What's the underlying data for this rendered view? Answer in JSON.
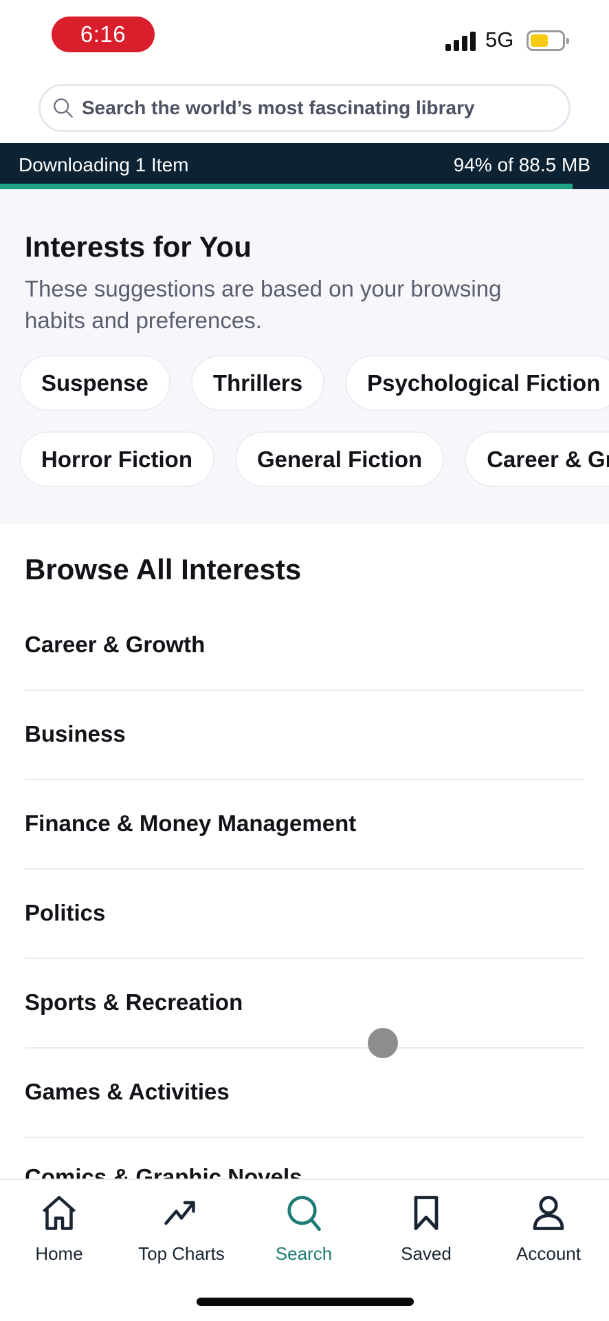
{
  "status_bar": {
    "time": "6:16",
    "network": "5G",
    "battery_level": 0.62,
    "battery_color": "#f6cb12",
    "time_pill_color": "#d91f2b"
  },
  "search": {
    "placeholder": "Search the world’s most fascinating library",
    "value": ""
  },
  "download_banner": {
    "label": "Downloading 1 Item",
    "progress_text": "94% of 88.5 MB",
    "progress_fraction": 0.94,
    "accent": "#1ea386"
  },
  "interests_for_you": {
    "title": "Interests for You",
    "description": "These suggestions are based on your browsing habits and preferences.",
    "chips_row1": [
      "Suspense",
      "Thrillers",
      "Psychological Fiction"
    ],
    "chips_row2": [
      "Horror Fiction",
      "General Fiction",
      "Career & Growth"
    ]
  },
  "browse_all": {
    "title": "Browse All Interests",
    "items": [
      "Career & Growth",
      "Business",
      "Finance & Money Management",
      "Politics",
      "Sports & Recreation",
      "Games & Activities",
      "Comics & Graphic Novels"
    ]
  },
  "tab_bar": {
    "active_color": "#1e7c74",
    "tabs": [
      {
        "label": "Home",
        "icon": "home-icon"
      },
      {
        "label": "Top Charts",
        "icon": "trending-icon"
      },
      {
        "label": "Search",
        "icon": "search-icon",
        "active": true
      },
      {
        "label": "Saved",
        "icon": "bookmark-icon"
      },
      {
        "label": "Account",
        "icon": "account-icon"
      }
    ]
  }
}
